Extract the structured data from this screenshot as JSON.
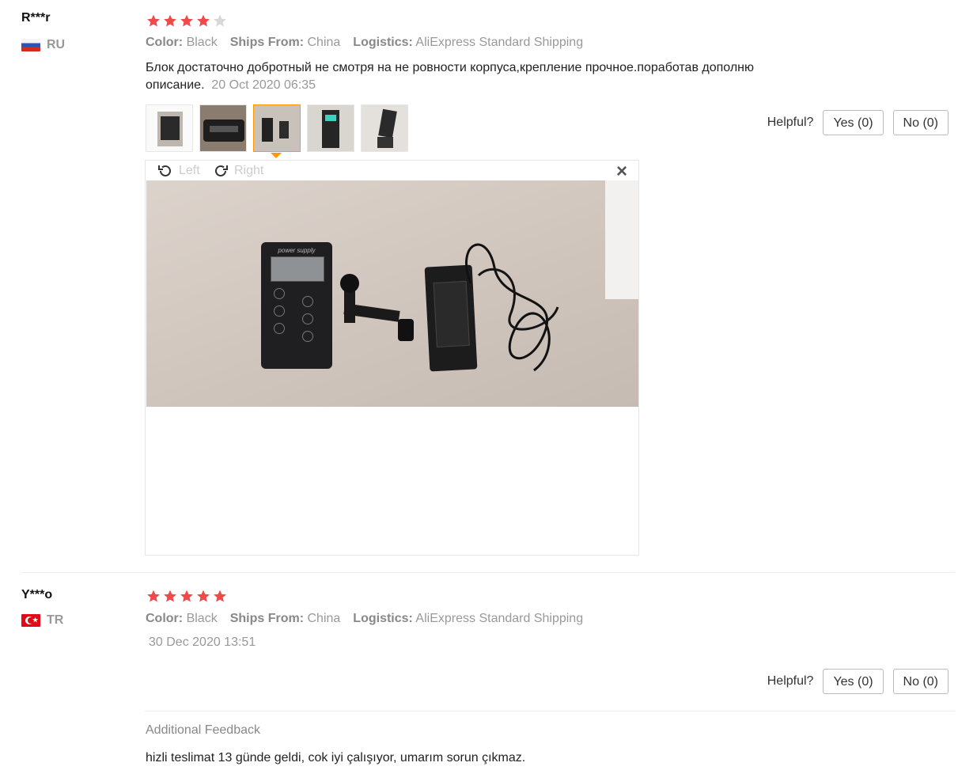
{
  "reviews": [
    {
      "name": "R***r",
      "country": "RU",
      "rating": 4,
      "meta": {
        "color_label": "Color:",
        "color_value": "Black",
        "ships_label": "Ships From:",
        "ships_value": "China",
        "logistics_label": "Logistics:",
        "logistics_value": "AliExpress Standard Shipping"
      },
      "text_line1": "Блок достаточно добротный не смотря на не ровности корпуса,крепление прочное.поработав дополню",
      "text_line2": "описание.",
      "date": "20 Oct 2020 06:35",
      "helpful_label": "Helpful?",
      "yes_label": "Yes (0)",
      "no_label": "No (0)",
      "viewer": {
        "rotate_left_label": "Left",
        "rotate_right_label": "Right",
        "close_glyph": "×",
        "image_caption": "power supply"
      }
    },
    {
      "name": "Y***o",
      "country": "TR",
      "rating": 5,
      "meta": {
        "color_label": "Color:",
        "color_value": "Black",
        "ships_label": "Ships From:",
        "ships_value": "China",
        "logistics_label": "Logistics:",
        "logistics_value": "AliExpress Standard Shipping"
      },
      "date": "30 Dec 2020 13:51",
      "helpful_label": "Helpful?",
      "yes_label": "Yes (0)",
      "no_label": "No (0)",
      "additional_label": "Additional Feedback",
      "additional_text": "hizli teslimat 13 günde geldi, cok iyi çalışıyor, umarım sorun çıkmaz."
    }
  ],
  "colors": {
    "star_on": "#f0494a",
    "star_off": "#d8d8d8",
    "active_thumb": "#ff9900"
  },
  "icons": {
    "star": "star-icon",
    "rotate_left": "rotate-left-icon",
    "rotate_right": "rotate-right-icon",
    "close": "close-icon"
  }
}
